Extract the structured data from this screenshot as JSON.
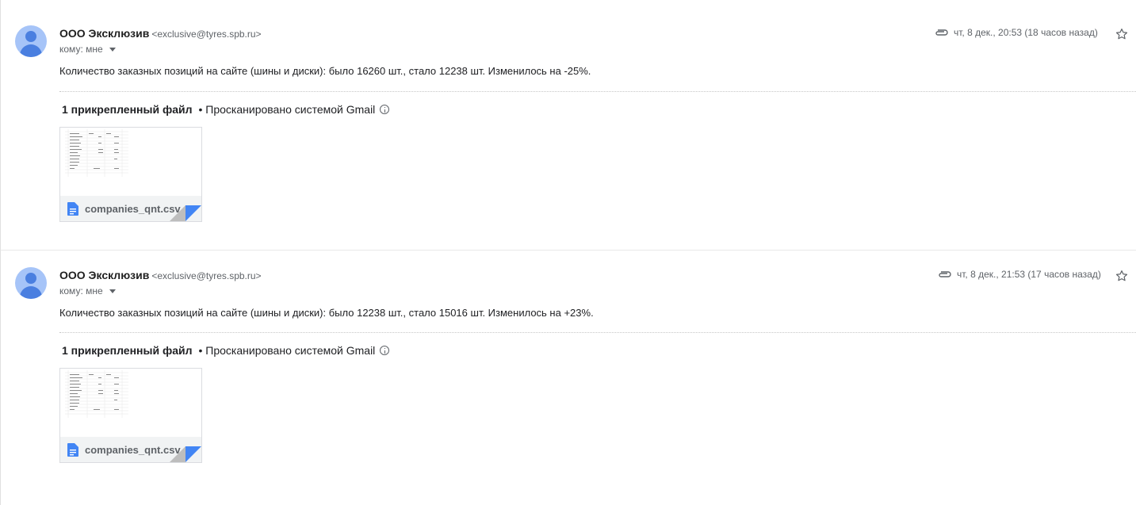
{
  "messages": [
    {
      "sender_name": "ООО Эксклюзив",
      "sender_email": "<exclusive@tyres.spb.ru>",
      "recipients": "кому: мне",
      "date": "чт, 8 дек., 20:53 (18 часов назад)",
      "body": "Количество заказных позиций на сайте (шины и диски): было 16260 шт., стало 12238 шт. Изменилось на -25%.",
      "attachments_count": "1 прикрепленный файл",
      "scan_note": "• Просканировано системой Gmail",
      "attachment_name": "companies_qnt.csv"
    },
    {
      "sender_name": "ООО Эксклюзив",
      "sender_email": "<exclusive@tyres.spb.ru>",
      "recipients": "кому: мне",
      "date": "чт, 8 дек., 21:53 (17 часов назад)",
      "body": "Количество заказных позиций на сайте (шины и диски): было 12238 шт., стало 15016 шт. Изменилось на +23%.",
      "attachments_count": "1 прикрепленный файл",
      "scan_note": "• Просканировано системой Gmail",
      "attachment_name": "companies_qnt.csv"
    }
  ],
  "icons": {
    "attachment": "paperclip-icon",
    "star": "star-icon",
    "info": "info-icon",
    "file": "doc-icon"
  },
  "colors": {
    "accent": "#4285f4",
    "avatar_bg": "#a6c4f8"
  }
}
